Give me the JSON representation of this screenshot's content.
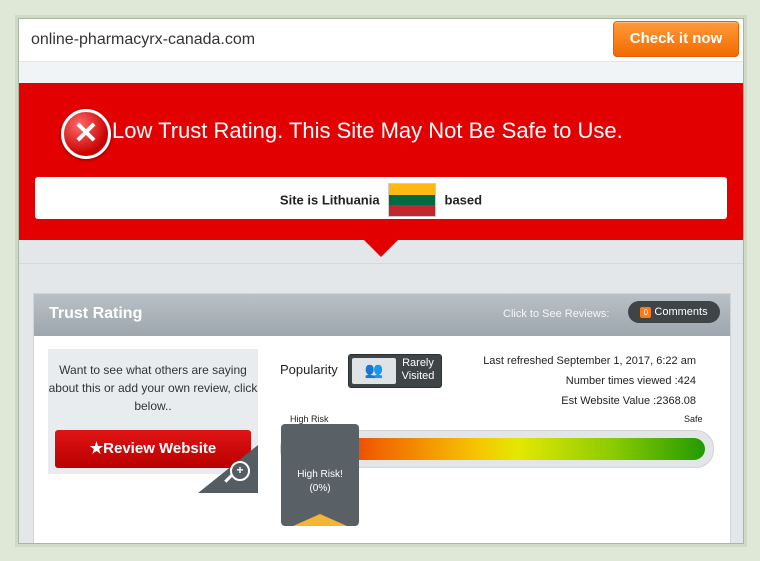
{
  "header": {
    "domain": "online-pharmacyrx-canada.com",
    "check_button": "Check it now"
  },
  "banner": {
    "title": "Low Trust Rating. This Site May Not Be Safe to Use.",
    "location_prefix": "Site is Lithuania",
    "location_suffix": "based",
    "flag_colors": [
      "#fdb913",
      "#006a44",
      "#c1272d"
    ],
    "color": "#e20000"
  },
  "panel": {
    "title": "Trust Rating",
    "reviews_hint": "Click to See Reviews:",
    "comments_button": "Comments",
    "comments_icon_text": "0"
  },
  "review": {
    "prompt": "Want to see what others are saying about this or add your own review, click below..",
    "button": "★Review Website"
  },
  "popularity": {
    "label": "Popularity",
    "badge": "Rarely Visited"
  },
  "stats": {
    "last_refreshed": "Last refreshed September 1, 2017, 6:22 am",
    "times_viewed": "Number times viewed :424",
    "website_value": "Est Website Value :2368.08"
  },
  "risk": {
    "left_label": "High Risk",
    "right_label": "Safe",
    "marker_label_line1": "High Risk!",
    "marker_label_line2": "(0%)",
    "score_percent": 0
  }
}
